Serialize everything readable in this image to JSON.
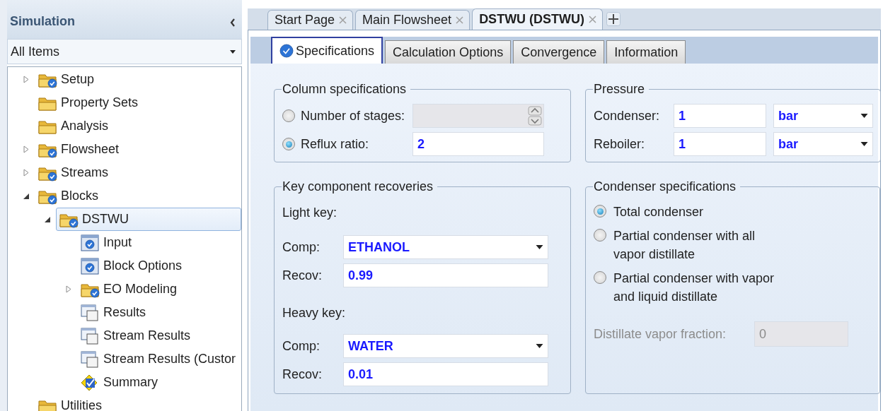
{
  "sidebar": {
    "title": "Simulation",
    "filter": {
      "value": "All Items"
    },
    "tree": [
      {
        "label": "Setup",
        "kind": "folder-check",
        "expanded": false,
        "selected": false
      },
      {
        "label": "Property Sets",
        "kind": "folder",
        "selected": false
      },
      {
        "label": "Analysis",
        "kind": "folder",
        "selected": false
      },
      {
        "label": "Flowsheet",
        "kind": "folder-check",
        "expanded": false,
        "selected": false
      },
      {
        "label": "Streams",
        "kind": "folder-check",
        "expanded": false,
        "selected": false
      },
      {
        "label": "Blocks",
        "kind": "folder-check",
        "expanded": true,
        "selected": false,
        "children": [
          {
            "label": "DSTWU",
            "kind": "folder-check",
            "expanded": true,
            "selected": true,
            "children": [
              {
                "label": "Input",
                "kind": "form-check",
                "selected": false
              },
              {
                "label": "Block Options",
                "kind": "form-check",
                "selected": false
              },
              {
                "label": "EO Modeling",
                "kind": "folder-check",
                "expanded": false,
                "selected": false
              },
              {
                "label": "Results",
                "kind": "form",
                "selected": false
              },
              {
                "label": "Stream Results",
                "kind": "form",
                "selected": false
              },
              {
                "label": "Stream Results (Custor",
                "kind": "form",
                "selected": false
              },
              {
                "label": "Summary",
                "kind": "summary",
                "selected": false
              }
            ]
          }
        ]
      },
      {
        "label": "Utilities",
        "kind": "folder",
        "selected": false
      }
    ]
  },
  "document_tabs": [
    {
      "label": "Start Page",
      "selected": false
    },
    {
      "label": "Main Flowsheet",
      "selected": false
    },
    {
      "label": "DSTWU (DSTWU)",
      "selected": true
    }
  ],
  "form_tabs": [
    {
      "label": "Specifications",
      "selected": true,
      "complete": true
    },
    {
      "label": "Calculation Options",
      "selected": false,
      "complete": false
    },
    {
      "label": "Convergence",
      "selected": false,
      "complete": false
    },
    {
      "label": "Information",
      "selected": false,
      "complete": false
    }
  ],
  "column_specifications": {
    "title": "Column specifications",
    "options": [
      {
        "label": "Number of stages:",
        "selected": false,
        "kind": "spinner",
        "disabled": true
      },
      {
        "label": "Reflux ratio:",
        "selected": true,
        "kind": "text",
        "disabled": false,
        "value": "2"
      }
    ]
  },
  "pressure": {
    "title": "Pressure",
    "rows": [
      {
        "label": "Condenser:",
        "value": "1",
        "unit": "bar"
      },
      {
        "label": "Reboiler:",
        "value": "1",
        "unit": "bar"
      }
    ]
  },
  "key_components": {
    "title": "Key component recoveries",
    "keys": [
      {
        "heading": "Light key:",
        "comp_label": "Comp:",
        "component": "ETHANOL",
        "recov_label": "Recov:",
        "recovery": "0.99"
      },
      {
        "heading": "Heavy key:",
        "comp_label": "Comp:",
        "component": "WATER",
        "recov_label": "Recov:",
        "recovery": "0.01"
      }
    ]
  },
  "condenser": {
    "title": "Condenser specifications",
    "options": [
      {
        "label": "Total condenser",
        "selected": true
      },
      {
        "label": "Partial condenser with all vapor distillate",
        "selected": false
      },
      {
        "label": "Partial condenser with vapor and liquid distillate",
        "selected": false
      }
    ],
    "vapor_fraction": {
      "label": "Distillate vapor fraction:",
      "value": "0",
      "disabled": true
    }
  }
}
